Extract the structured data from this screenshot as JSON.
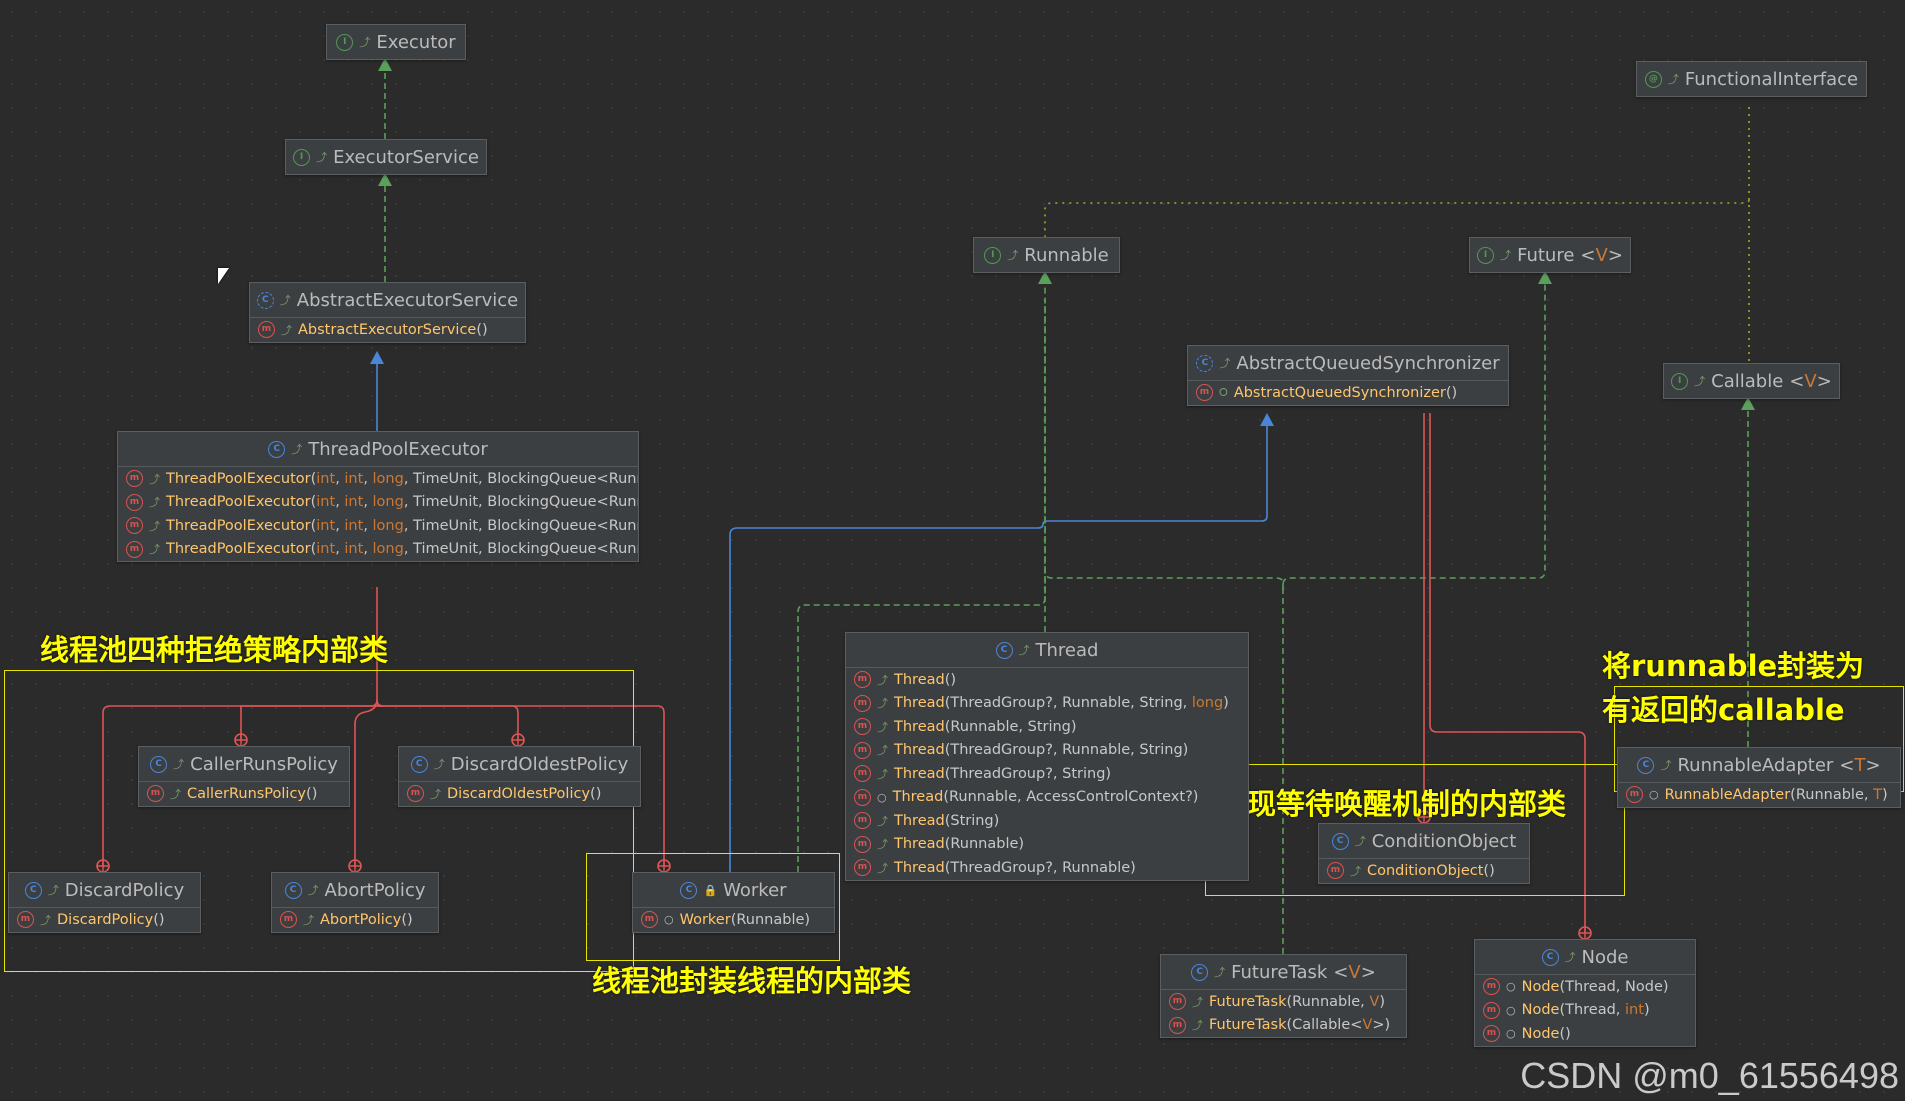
{
  "colors": {
    "interface_edge": "#5aa05a",
    "extends_edge": "#4a86d8",
    "inner_edge": "#e05555",
    "annotation": "#ffff00"
  },
  "nodes": [
    {
      "id": "executor",
      "kind": "interface",
      "title": "Executor",
      "rows": []
    },
    {
      "id": "executor-service",
      "kind": "interface",
      "title": "ExecutorService",
      "rows": []
    },
    {
      "id": "abstract-executor-service",
      "kind": "abstract",
      "title": "AbstractExecutorService",
      "rows": [
        {
          "vis": "pub",
          "parts": [
            [
              "ctor",
              "AbstractExecutorService"
            ],
            [
              "param",
              "()"
            ]
          ]
        }
      ]
    },
    {
      "id": "thread-pool-executor",
      "kind": "class",
      "title": "ThreadPoolExecutor",
      "rows": [
        {
          "vis": "pub",
          "parts": [
            [
              "ctor",
              "ThreadPoolExecutor"
            ],
            [
              "param",
              "("
            ],
            [
              "generic",
              "int"
            ],
            [
              "param",
              ", "
            ],
            [
              "generic",
              "int"
            ],
            [
              "param",
              ", "
            ],
            [
              "generic",
              "long"
            ],
            [
              "param",
              ", TimeUnit, BlockingQueue<Runnable>, ThreadFactory)"
            ]
          ]
        },
        {
          "vis": "pub",
          "parts": [
            [
              "ctor",
              "ThreadPoolExecutor"
            ],
            [
              "param",
              "("
            ],
            [
              "generic",
              "int"
            ],
            [
              "param",
              ", "
            ],
            [
              "generic",
              "int"
            ],
            [
              "param",
              ", "
            ],
            [
              "generic",
              "long"
            ],
            [
              "param",
              ", TimeUnit, BlockingQueue<Runnable>)"
            ]
          ]
        },
        {
          "vis": "pub",
          "parts": [
            [
              "ctor",
              "ThreadPoolExecutor"
            ],
            [
              "param",
              "("
            ],
            [
              "generic",
              "int"
            ],
            [
              "param",
              ", "
            ],
            [
              "generic",
              "int"
            ],
            [
              "param",
              ", "
            ],
            [
              "generic",
              "long"
            ],
            [
              "param",
              ", TimeUnit, BlockingQueue<Runnable>, RejectedExecutionHandler)"
            ]
          ]
        },
        {
          "vis": "pub",
          "parts": [
            [
              "ctor",
              "ThreadPoolExecutor"
            ],
            [
              "param",
              "("
            ],
            [
              "generic",
              "int"
            ],
            [
              "param",
              ", "
            ],
            [
              "generic",
              "int"
            ],
            [
              "param",
              ", "
            ],
            [
              "generic",
              "long"
            ],
            [
              "param",
              ", TimeUnit, BlockingQueue<Runnable>, ThreadFactory, RejectedExecutionHandler)"
            ]
          ]
        }
      ]
    },
    {
      "id": "caller-runs-policy",
      "kind": "class-static",
      "title": "CallerRunsPolicy",
      "rows": [
        {
          "vis": "pub",
          "parts": [
            [
              "ctor",
              "CallerRunsPolicy"
            ],
            [
              "param",
              "()"
            ]
          ]
        }
      ]
    },
    {
      "id": "discard-oldest-policy",
      "kind": "class-static",
      "title": "DiscardOldestPolicy",
      "rows": [
        {
          "vis": "pub",
          "parts": [
            [
              "ctor",
              "DiscardOldestPolicy"
            ],
            [
              "param",
              "()"
            ]
          ]
        }
      ]
    },
    {
      "id": "discard-policy",
      "kind": "class-static",
      "title": "DiscardPolicy",
      "rows": [
        {
          "vis": "pub",
          "parts": [
            [
              "ctor",
              "DiscardPolicy"
            ],
            [
              "param",
              "()"
            ]
          ]
        }
      ]
    },
    {
      "id": "abort-policy",
      "kind": "class-static",
      "title": "AbortPolicy",
      "rows": [
        {
          "vis": "pub",
          "parts": [
            [
              "ctor",
              "AbortPolicy"
            ],
            [
              "param",
              "()"
            ]
          ]
        }
      ]
    },
    {
      "id": "worker",
      "kind": "class-private",
      "title": "Worker",
      "rows": [
        {
          "vis": "pkg",
          "parts": [
            [
              "ctor",
              "Worker"
            ],
            [
              "param",
              "(Runnable)"
            ]
          ]
        }
      ]
    },
    {
      "id": "runnable",
      "kind": "interface",
      "title": "Runnable",
      "rows": []
    },
    {
      "id": "future",
      "kind": "interface",
      "title": "Future",
      "generic": "V",
      "rows": []
    },
    {
      "id": "functional-interface",
      "kind": "annotation",
      "title": "FunctionalInterface",
      "rows": []
    },
    {
      "id": "callable",
      "kind": "interface",
      "title": "Callable",
      "generic": "V",
      "rows": []
    },
    {
      "id": "aqs",
      "kind": "abstract",
      "title": "AbstractQueuedSynchronizer",
      "rows": [
        {
          "vis": "prot",
          "parts": [
            [
              "ctor",
              "AbstractQueuedSynchronizer"
            ],
            [
              "param",
              "()"
            ]
          ]
        }
      ]
    },
    {
      "id": "thread",
      "kind": "class",
      "title": "Thread",
      "rows": [
        {
          "vis": "pub",
          "parts": [
            [
              "ctor",
              "Thread"
            ],
            [
              "param",
              "()"
            ]
          ]
        },
        {
          "vis": "pub",
          "parts": [
            [
              "ctor",
              "Thread"
            ],
            [
              "param",
              "(ThreadGroup?, Runnable, String, "
            ],
            [
              "generic",
              "long"
            ],
            [
              "param",
              ")"
            ]
          ]
        },
        {
          "vis": "pub",
          "parts": [
            [
              "ctor",
              "Thread"
            ],
            [
              "param",
              "(Runnable, String)"
            ]
          ]
        },
        {
          "vis": "pub",
          "parts": [
            [
              "ctor",
              "Thread"
            ],
            [
              "param",
              "(ThreadGroup?, Runnable, String)"
            ]
          ]
        },
        {
          "vis": "pub",
          "parts": [
            [
              "ctor",
              "Thread"
            ],
            [
              "param",
              "(ThreadGroup?, String)"
            ]
          ]
        },
        {
          "vis": "pkg",
          "parts": [
            [
              "ctor",
              "Thread"
            ],
            [
              "param",
              "(Runnable, AccessControlContext?)"
            ]
          ]
        },
        {
          "vis": "pub",
          "parts": [
            [
              "ctor",
              "Thread"
            ],
            [
              "param",
              "(String)"
            ]
          ]
        },
        {
          "vis": "pub",
          "parts": [
            [
              "ctor",
              "Thread"
            ],
            [
              "param",
              "(Runnable)"
            ]
          ]
        },
        {
          "vis": "pub",
          "parts": [
            [
              "ctor",
              "Thread"
            ],
            [
              "param",
              "(ThreadGroup?, Runnable)"
            ]
          ]
        }
      ]
    },
    {
      "id": "condition-object",
      "kind": "class",
      "title": "ConditionObject",
      "rows": [
        {
          "vis": "pub",
          "parts": [
            [
              "ctor",
              "ConditionObject"
            ],
            [
              "param",
              "()"
            ]
          ]
        }
      ]
    },
    {
      "id": "runnable-adapter",
      "kind": "class-static",
      "title": "RunnableAdapter",
      "generic": "T",
      "rows": [
        {
          "vis": "pkg",
          "parts": [
            [
              "ctor",
              "RunnableAdapter"
            ],
            [
              "param",
              "(Runnable, "
            ],
            [
              "generic",
              "T"
            ],
            [
              "param",
              ")"
            ]
          ]
        }
      ]
    },
    {
      "id": "future-task",
      "kind": "class",
      "title": "FutureTask",
      "generic": "V",
      "rows": [
        {
          "vis": "pub",
          "parts": [
            [
              "ctor",
              "FutureTask"
            ],
            [
              "param",
              "(Runnable, "
            ],
            [
              "generic",
              "V"
            ],
            [
              "param",
              ")"
            ]
          ]
        },
        {
          "vis": "pub",
          "parts": [
            [
              "ctor",
              "FutureTask"
            ],
            [
              "param",
              "(Callable<"
            ],
            [
              "generic",
              "V"
            ],
            [
              "param",
              ">)"
            ]
          ]
        }
      ]
    },
    {
      "id": "node",
      "kind": "class-static",
      "title": "Node",
      "rows": [
        {
          "vis": "pkg",
          "parts": [
            [
              "ctor",
              "Node"
            ],
            [
              "param",
              "(Thread, Node)"
            ]
          ]
        },
        {
          "vis": "pkg",
          "parts": [
            [
              "ctor",
              "Node"
            ],
            [
              "param",
              "(Thread, "
            ],
            [
              "generic",
              "int"
            ],
            [
              "param",
              ")"
            ]
          ]
        },
        {
          "vis": "pkg",
          "parts": [
            [
              "ctor",
              "Node"
            ],
            [
              "param",
              "()"
            ]
          ]
        }
      ]
    }
  ],
  "annotations": {
    "rejection": "线程池四种拒绝策略内部类",
    "worker": "线程池封装线程的内部类",
    "condition": "实现等待唤醒机制的内部类",
    "adapter_line1": "将runnable封装为",
    "adapter_line2": "有返回的callable"
  },
  "watermark": "CSDN @m0_61556498"
}
